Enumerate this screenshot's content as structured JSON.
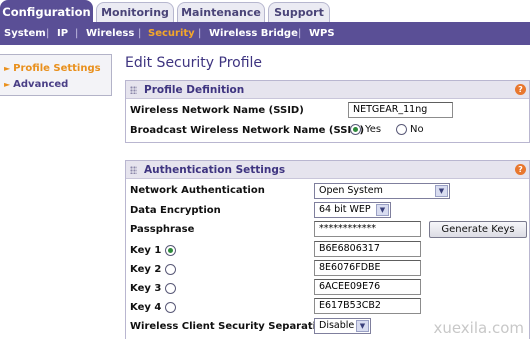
{
  "top_tabs": [
    "Configuration",
    "Monitoring",
    "Maintenance",
    "Support"
  ],
  "sub_nav": [
    "System",
    "IP",
    "Wireless",
    "Security",
    "Wireless Bridge",
    "WPS"
  ],
  "sidebar": {
    "items": [
      {
        "label": "Profile Settings"
      },
      {
        "label": "Advanced"
      }
    ]
  },
  "page_title": "Edit Security Profile",
  "profile_definition": {
    "title": "Profile Definition",
    "ssid_label": "Wireless Network Name (SSID)",
    "ssid_value": "NETGEAR_11ng",
    "broadcast_label": "Broadcast Wireless Network Name (SSID)",
    "yes_label": "Yes",
    "no_label": "No",
    "broadcast_selected": "Yes"
  },
  "authentication": {
    "title": "Authentication Settings",
    "network_auth_label": "Network Authentication",
    "network_auth_value": "Open System",
    "data_encryption_label": "Data Encryption",
    "data_encryption_value": "64 bit WEP",
    "passphrase_label": "Passphrase",
    "passphrase_value": "************",
    "generate_keys_label": "Generate Keys",
    "keys": [
      {
        "label": "Key 1",
        "value": "B6E6806317",
        "selected": true
      },
      {
        "label": "Key 2",
        "value": "8E6076FDBE",
        "selected": false
      },
      {
        "label": "Key 3",
        "value": "6ACEE09E76",
        "selected": false
      },
      {
        "label": "Key 4",
        "value": "E617B53CB2",
        "selected": false
      }
    ],
    "separation_label": "Wireless Client Security Separation",
    "separation_value": "Disable"
  },
  "help_glyph": "?",
  "watermark": "xuexila.com",
  "colors": {
    "brand_purple": "#5a4f96",
    "active_orange": "#f4a72a",
    "section_header": "#e6e4ee",
    "radio_green": "#2f8a3c"
  }
}
